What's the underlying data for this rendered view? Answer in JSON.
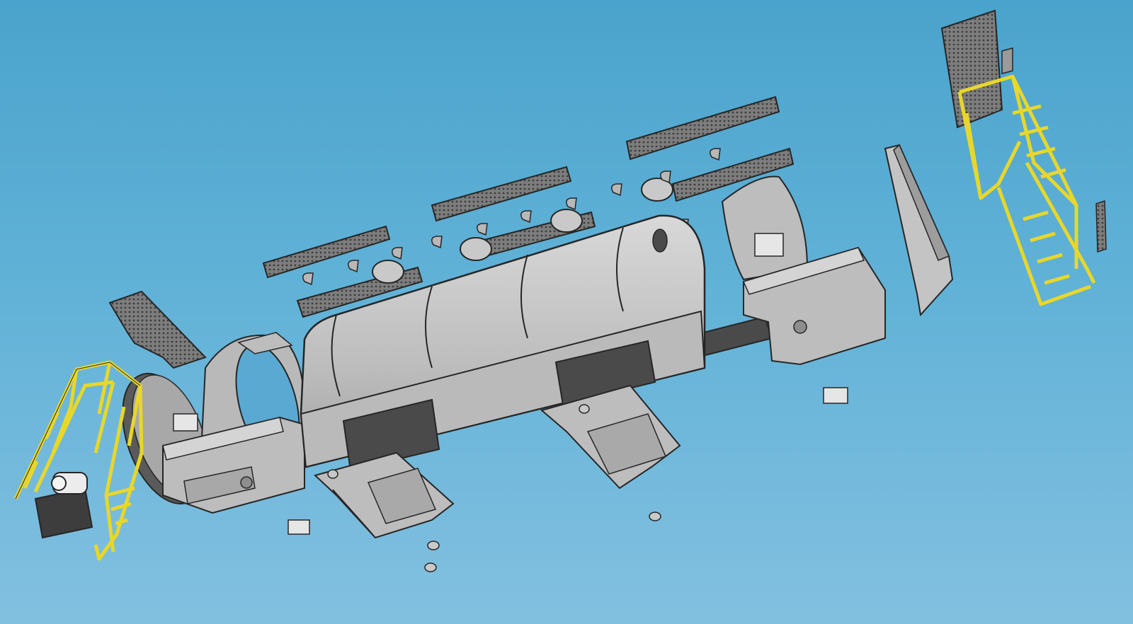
{
  "viewport": {
    "background_top": "#4aa3cc",
    "background_bottom": "#83c0e0"
  },
  "colors": {
    "metal_light": "#c9c9c9",
    "metal_mid": "#b3b3b3",
    "metal_dark": "#8d8d8d",
    "edge": "#262626",
    "mesh": "#6b6b6b",
    "beam": "#4a4a4a",
    "rail": "#e8d72a"
  },
  "parts": [
    "main-drum-shell",
    "drive-shaft",
    "front-ring-flange",
    "end-disc",
    "front-drive-housing",
    "rear-ring-housing",
    "rear-drive-housing",
    "support-stand-left",
    "support-stand-right",
    "chute-bracket",
    "grating-panel-left",
    "grating-panel-center",
    "grating-panel-upper",
    "grating-panel-right",
    "grating-panel-far-right",
    "walkway-with-ladder-left",
    "walkway-with-ladder-right",
    "drive-motor",
    "inspection-hatches",
    "bolt-pins",
    "feet-pads",
    "small-blocks"
  ]
}
